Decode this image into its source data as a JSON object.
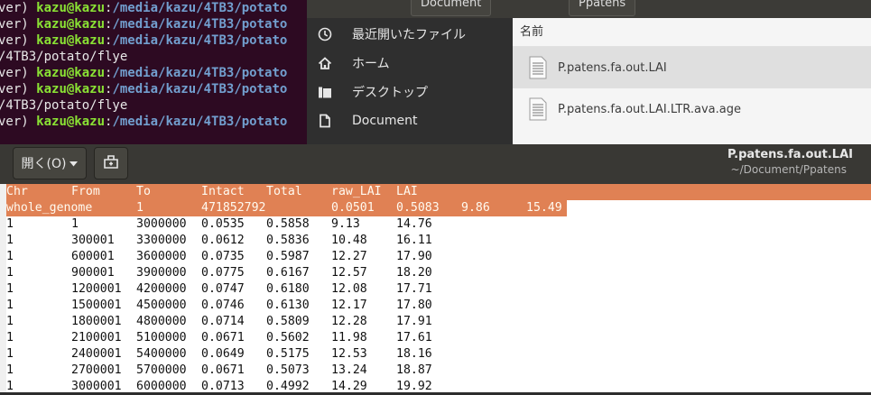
{
  "terminal": {
    "lines": [
      {
        "pre": "ver) ",
        "user": "kazu@kazu",
        "sep": ":",
        "path": "/media/kazu/4TB3/potato"
      },
      {
        "pre": "ver) ",
        "user": "kazu@kazu",
        "sep": ":",
        "path": "/media/kazu/4TB3/potato"
      },
      {
        "pre": "ver) ",
        "user": "kazu@kazu",
        "sep": ":",
        "path": "/media/kazu/4TB3/potato"
      },
      {
        "plain": "/4TB3/potato/flye"
      },
      {
        "pre": "ver) ",
        "user": "kazu@kazu",
        "sep": ":",
        "path": "/media/kazu/4TB3/potato"
      },
      {
        "pre": "ver) ",
        "user": "kazu@kazu",
        "sep": ":",
        "path": "/media/kazu/4TB3/potato"
      },
      {
        "plain": "/4TB3/potato/flye"
      },
      {
        "pre": "ver) ",
        "user": "kazu@kazu",
        "sep": ":",
        "path": "/media/kazu/4TB3/potato"
      }
    ]
  },
  "file_manager": {
    "crumbs": [
      "Document",
      "Ppatens"
    ],
    "sidebar": [
      {
        "label": "最近開いたファイル",
        "icon": "clock-icon"
      },
      {
        "label": "ホーム",
        "icon": "home-icon"
      },
      {
        "label": "デスクトップ",
        "icon": "folder-icon"
      },
      {
        "label": "Document",
        "icon": "document-icon"
      }
    ],
    "column_header": "名前",
    "files": [
      {
        "name": "P.patens.fa.out.LAI",
        "selected": true
      },
      {
        "name": "P.patens.fa.out.LAI.LTR.ava.age",
        "selected": false
      }
    ]
  },
  "editor": {
    "open_label": "開く(O)",
    "title": "P.patens.fa.out.LAI",
    "subtitle": "~/Document/Ppatens",
    "header": [
      "Chr",
      "From",
      "To",
      "Intact",
      "Total",
      "raw_LAI",
      "LAI"
    ],
    "genome_row": [
      "whole_genome",
      "1",
      "471852792",
      "0.0501",
      "0.5083",
      "9.86",
      "15.49"
    ],
    "rows": [
      [
        "1",
        "1",
        "3000000",
        "0.0535",
        "0.5858",
        "9.13",
        "14.76"
      ],
      [
        "1",
        "300001",
        "3300000",
        "0.0612",
        "0.5836",
        "10.48",
        "16.11"
      ],
      [
        "1",
        "600001",
        "3600000",
        "0.0735",
        "0.5987",
        "12.27",
        "17.90"
      ],
      [
        "1",
        "900001",
        "3900000",
        "0.0775",
        "0.6167",
        "12.57",
        "18.20"
      ],
      [
        "1",
        "1200001",
        "4200000",
        "0.0747",
        "0.6180",
        "12.08",
        "17.71"
      ],
      [
        "1",
        "1500001",
        "4500000",
        "0.0746",
        "0.6130",
        "12.17",
        "17.80"
      ],
      [
        "1",
        "1800001",
        "4800000",
        "0.0714",
        "0.5809",
        "12.28",
        "17.91"
      ],
      [
        "1",
        "2100001",
        "5100000",
        "0.0671",
        "0.5602",
        "11.98",
        "17.61"
      ],
      [
        "1",
        "2400001",
        "5400000",
        "0.0649",
        "0.5175",
        "12.53",
        "18.16"
      ],
      [
        "1",
        "2700001",
        "5700000",
        "0.0671",
        "0.5073",
        "13.24",
        "18.87"
      ],
      [
        "1",
        "3000001",
        "6000000",
        "0.0713",
        "0.4992",
        "14.29",
        "19.92"
      ]
    ]
  },
  "colors": {
    "highlight": "#e08154",
    "terminal_bg": "#2d0a22",
    "user": "#8ae234",
    "path": "#729fcf"
  }
}
